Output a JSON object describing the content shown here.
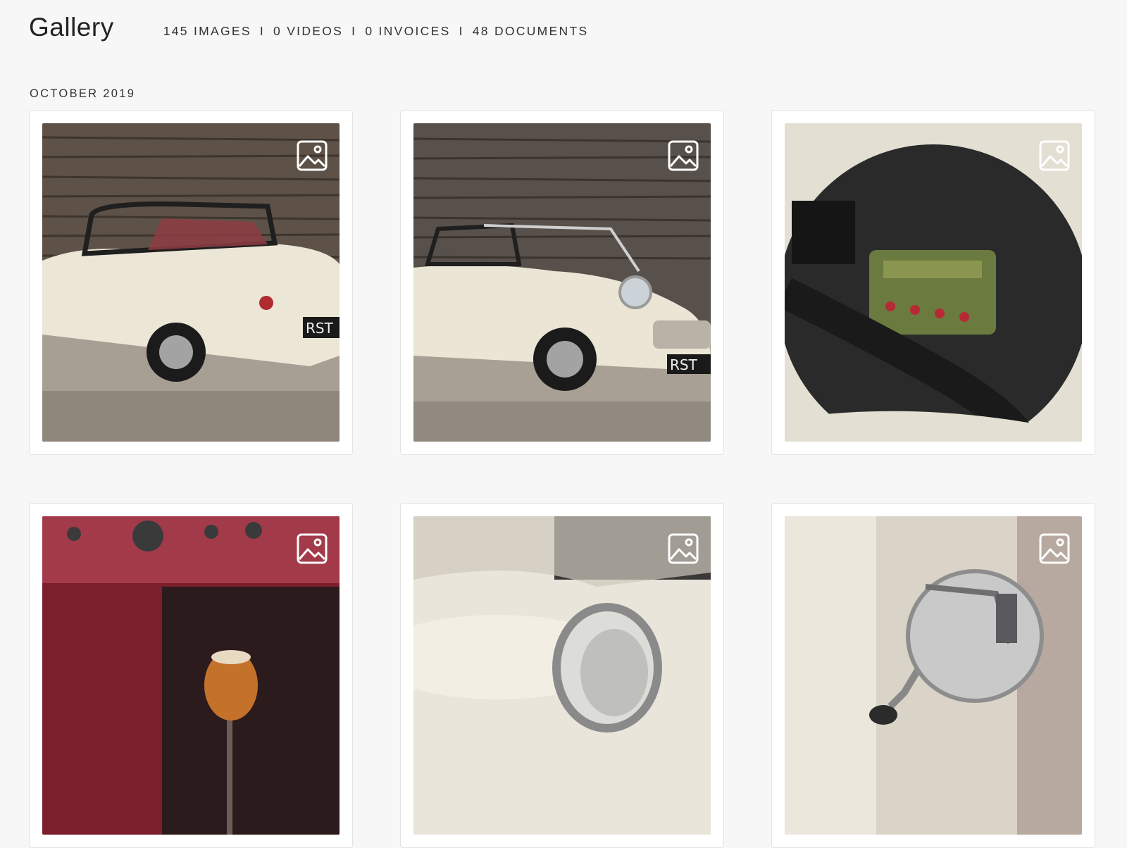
{
  "page": {
    "title": "Gallery",
    "stats": {
      "images": "145 IMAGES",
      "videos": "0 VIDEOS",
      "invoices": "0 INVOICES",
      "documents": "48 DOCUMENTS",
      "separator": "I"
    }
  },
  "section": {
    "label": "OCTOBER 2019"
  },
  "colors": {
    "background": "#f7f7f7",
    "card": "#ffffff",
    "card_border": "#e3e3e3",
    "text": "#2a2a2a"
  },
  "icons": {
    "media_type": "image-icon"
  }
}
